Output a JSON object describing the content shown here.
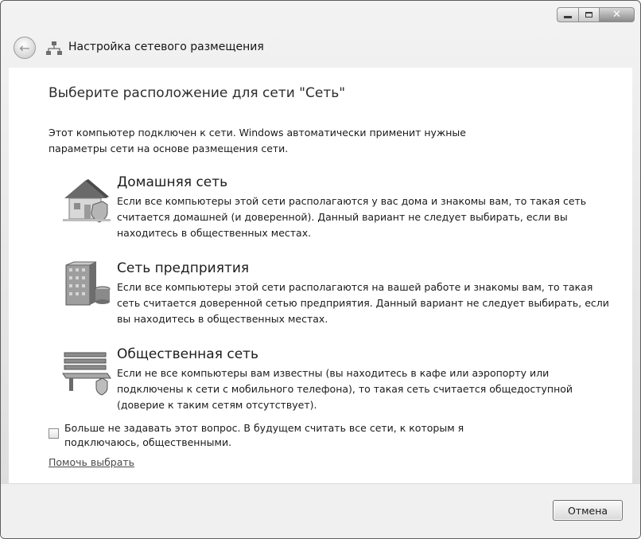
{
  "window": {
    "title": "Настройка сетевого размещения",
    "caption_buttons": {
      "minimize_icon": "minimize-icon",
      "maximize_icon": "maximize-icon",
      "close_icon": "close-icon",
      "close_glyph": "✕"
    },
    "back_glyph": "←"
  },
  "main": {
    "heading": "Выберите расположение для сети \"Сеть\"",
    "intro": "Этот компьютер подключен к сети. Windows автоматически применит нужные параметры сети на основе размещения сети.",
    "options": [
      {
        "title": "Домашняя сеть",
        "description": "Если все компьютеры этой сети располагаются у вас дома и знакомы вам, то такая сеть считается домашней (и доверенной). Данный вариант не следует выбирать, если вы находитесь в общественных местах.",
        "icon": "home-icon"
      },
      {
        "title": "Сеть предприятия",
        "description": "Если все компьютеры этой сети располагаются на вашей работе и знакомы вам, то такая сеть считается доверенной сетью предприятия. Данный вариант не следует выбирать, если вы находитесь в общественных местах.",
        "icon": "office-building-icon"
      },
      {
        "title": "Общественная сеть",
        "description": "Если не все компьютеры вам известны (вы находитесь в кафе или аэропорту или подключены к сети с мобильного телефона), то такая сеть считается общедоступной (доверие к таким сетям отсутствует).",
        "icon": "park-bench-icon"
      }
    ],
    "checkbox": {
      "label": "Больше не задавать этот вопрос. В будущем считать все сети, к которым я подключаюсь, общественными.",
      "checked": false
    },
    "help_link": "Помочь выбрать"
  },
  "footer": {
    "cancel_label": "Отмена"
  },
  "colors": {
    "window_frame": "#dcdcdc",
    "content_bg": "#ffffff",
    "footer_bg": "#f0f0f0"
  }
}
